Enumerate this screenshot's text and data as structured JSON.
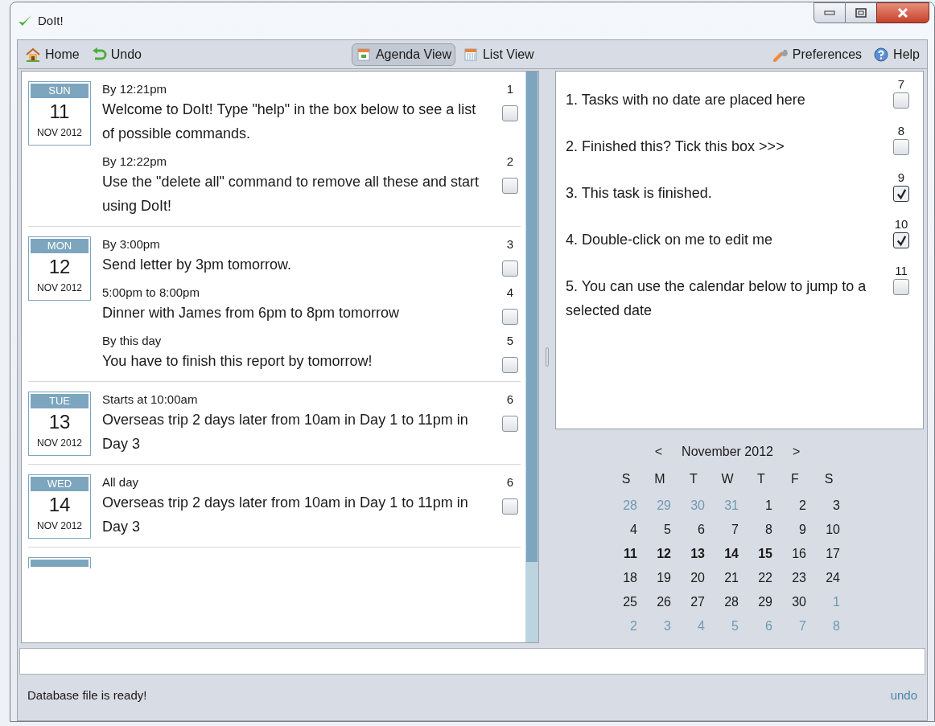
{
  "window": {
    "title": "DoIt!"
  },
  "toolbar": {
    "left": [
      {
        "kind": "home",
        "label": "Home"
      },
      {
        "kind": "undo",
        "label": "Undo"
      }
    ],
    "views": [
      {
        "kind": "agenda",
        "label": "Agenda View",
        "selected": true
      },
      {
        "kind": "list",
        "label": "List View",
        "selected": false
      }
    ],
    "right": [
      {
        "kind": "preferences",
        "label": "Preferences"
      },
      {
        "kind": "help",
        "label": "Help"
      }
    ]
  },
  "agenda": [
    {
      "weekday": "SUN",
      "day": "11",
      "month": "NOV 2012",
      "tasks": [
        {
          "time": "By 12:21pm",
          "text": "Welcome to DoIt! Type \"help\" in the box below to see a list of possible commands.",
          "number": "1",
          "checked": false
        },
        {
          "time": "By 12:22pm",
          "text": "Use the \"delete all\" command to remove all these and start using DoIt!",
          "number": "2",
          "checked": false
        }
      ]
    },
    {
      "weekday": "MON",
      "day": "12",
      "month": "NOV 2012",
      "tasks": [
        {
          "time": "By 3:00pm",
          "text": "Send letter by 3pm tomorrow.",
          "number": "3",
          "checked": false
        },
        {
          "time": "5:00pm to 8:00pm",
          "text": "Dinner with James from 6pm to 8pm tomorrow",
          "number": "4",
          "checked": false
        },
        {
          "time": "By this day",
          "text": "You have to finish this report by tomorrow!",
          "number": "5",
          "checked": false
        }
      ]
    },
    {
      "weekday": "TUE",
      "day": "13",
      "month": "NOV 2012",
      "tasks": [
        {
          "time": "Starts at 10:00am",
          "text": "Overseas trip 2 days later from 10am in Day 1 to 11pm in Day 3",
          "number": "6",
          "checked": false
        }
      ]
    },
    {
      "weekday": "WED",
      "day": "14",
      "month": "NOV 2012",
      "tasks": [
        {
          "time": "All day",
          "text": "Overseas trip 2 days later from 10am in Day 1 to 11pm in Day 3",
          "number": "6",
          "checked": false
        }
      ]
    }
  ],
  "floating_tasks": [
    {
      "text": "1. Tasks with no date are placed here",
      "number": "7",
      "checked": false
    },
    {
      "text": "2. Finished this? Tick this box >>>",
      "number": "8",
      "checked": false
    },
    {
      "text": "3. This task is finished.",
      "number": "9",
      "checked": true
    },
    {
      "text": "4. Double-click on me to edit me",
      "number": "10",
      "checked": true
    },
    {
      "text": "5. You can use the calendar below to jump to a selected date",
      "number": "11",
      "checked": false
    }
  ],
  "calendar": {
    "prev": "<",
    "title": "November 2012",
    "next": ">",
    "weekdays": [
      "S",
      "M",
      "T",
      "W",
      "T",
      "F",
      "S"
    ],
    "days": [
      {
        "label": "28",
        "other_month": true,
        "has_tasks": false
      },
      {
        "label": "29",
        "other_month": true,
        "has_tasks": false
      },
      {
        "label": "30",
        "other_month": true,
        "has_tasks": false
      },
      {
        "label": "31",
        "other_month": true,
        "has_tasks": false
      },
      {
        "label": "1",
        "other_month": false,
        "has_tasks": false
      },
      {
        "label": "2",
        "other_month": false,
        "has_tasks": false
      },
      {
        "label": "3",
        "other_month": false,
        "has_tasks": false
      },
      {
        "label": "4",
        "other_month": false,
        "has_tasks": false
      },
      {
        "label": "5",
        "other_month": false,
        "has_tasks": false
      },
      {
        "label": "6",
        "other_month": false,
        "has_tasks": false
      },
      {
        "label": "7",
        "other_month": false,
        "has_tasks": false
      },
      {
        "label": "8",
        "other_month": false,
        "has_tasks": false
      },
      {
        "label": "9",
        "other_month": false,
        "has_tasks": false
      },
      {
        "label": "10",
        "other_month": false,
        "has_tasks": false
      },
      {
        "label": "11",
        "other_month": false,
        "has_tasks": true
      },
      {
        "label": "12",
        "other_month": false,
        "has_tasks": true
      },
      {
        "label": "13",
        "other_month": false,
        "has_tasks": true
      },
      {
        "label": "14",
        "other_month": false,
        "has_tasks": true
      },
      {
        "label": "15",
        "other_month": false,
        "has_tasks": true
      },
      {
        "label": "16",
        "other_month": false,
        "has_tasks": false
      },
      {
        "label": "17",
        "other_month": false,
        "has_tasks": false
      },
      {
        "label": "18",
        "other_month": false,
        "has_tasks": false
      },
      {
        "label": "19",
        "other_month": false,
        "has_tasks": false
      },
      {
        "label": "20",
        "other_month": false,
        "has_tasks": false
      },
      {
        "label": "21",
        "other_month": false,
        "has_tasks": false
      },
      {
        "label": "22",
        "other_month": false,
        "has_tasks": false
      },
      {
        "label": "23",
        "other_month": false,
        "has_tasks": false
      },
      {
        "label": "24",
        "other_month": false,
        "has_tasks": false
      },
      {
        "label": "25",
        "other_month": false,
        "has_tasks": false
      },
      {
        "label": "26",
        "other_month": false,
        "has_tasks": false
      },
      {
        "label": "27",
        "other_month": false,
        "has_tasks": false
      },
      {
        "label": "28",
        "other_month": false,
        "has_tasks": false
      },
      {
        "label": "29",
        "other_month": false,
        "has_tasks": false
      },
      {
        "label": "30",
        "other_month": false,
        "has_tasks": false
      },
      {
        "label": "1",
        "other_month": true,
        "has_tasks": false
      },
      {
        "label": "2",
        "other_month": true,
        "has_tasks": false
      },
      {
        "label": "3",
        "other_month": true,
        "has_tasks": false
      },
      {
        "label": "4",
        "other_month": true,
        "has_tasks": false
      },
      {
        "label": "5",
        "other_month": true,
        "has_tasks": false
      },
      {
        "label": "6",
        "other_month": true,
        "has_tasks": false
      },
      {
        "label": "7",
        "other_month": true,
        "has_tasks": false
      },
      {
        "label": "8",
        "other_month": true,
        "has_tasks": false
      }
    ]
  },
  "status_bar": {
    "message": "Database file is ready!",
    "link": "undo"
  }
}
